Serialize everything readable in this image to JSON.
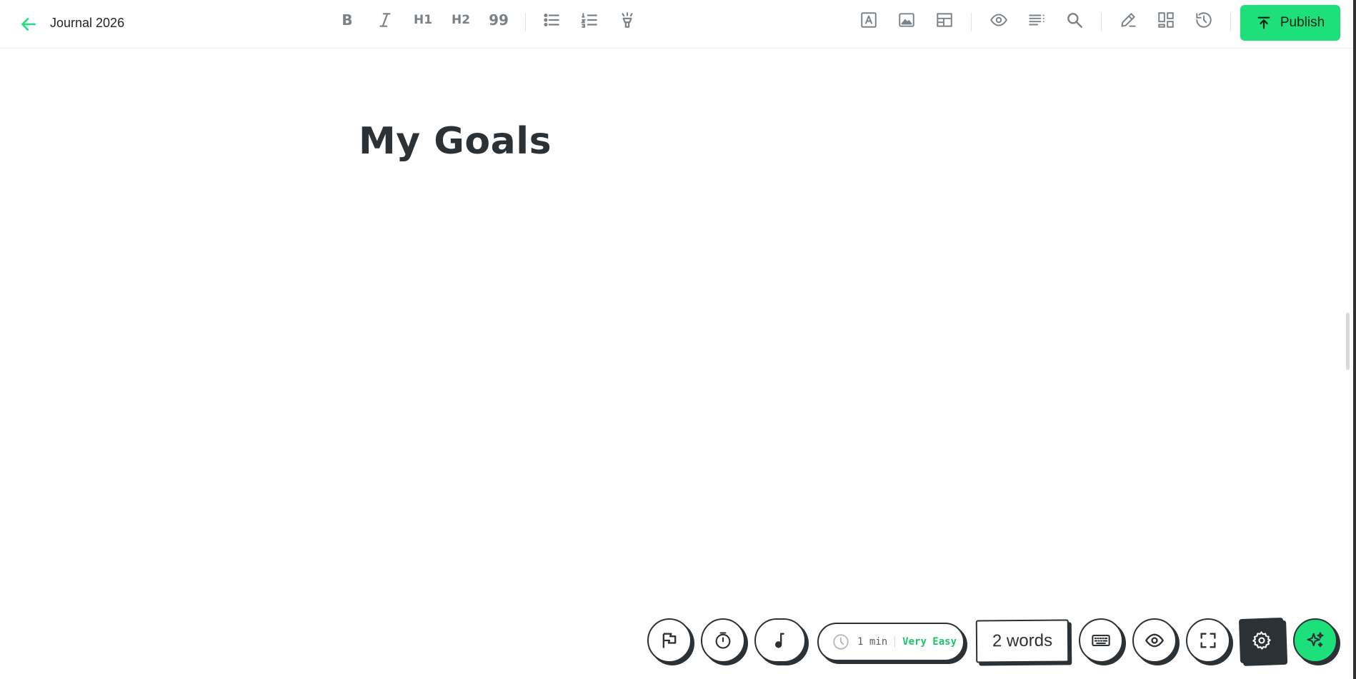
{
  "header": {
    "title": "Journal 2026",
    "publish_label": "Publish"
  },
  "toolbar": {
    "bold": "B",
    "h1": "H1",
    "h2": "H2",
    "quote": "99"
  },
  "editor": {
    "heading": "My Goals"
  },
  "statusbar": {
    "read_time": "1 min",
    "readability": "Very Easy",
    "word_count": "2 words"
  },
  "colors": {
    "accent": "#1ee07a",
    "ink": "#2b3135",
    "icon": "#7b8287"
  },
  "icons": [
    "back-arrow-icon",
    "italic-icon",
    "bullet-list-icon",
    "numbered-list-icon",
    "highlight-icon",
    "text-box-icon",
    "image-icon",
    "table-icon",
    "eye-icon",
    "outline-icon",
    "search-icon",
    "edit-icon",
    "layout-icon",
    "history-icon",
    "upload-icon",
    "flag-icon",
    "timer-icon",
    "music-icon",
    "clock-icon",
    "keyboard-icon",
    "fullscreen-icon",
    "gear-icon",
    "sparkle-icon"
  ]
}
